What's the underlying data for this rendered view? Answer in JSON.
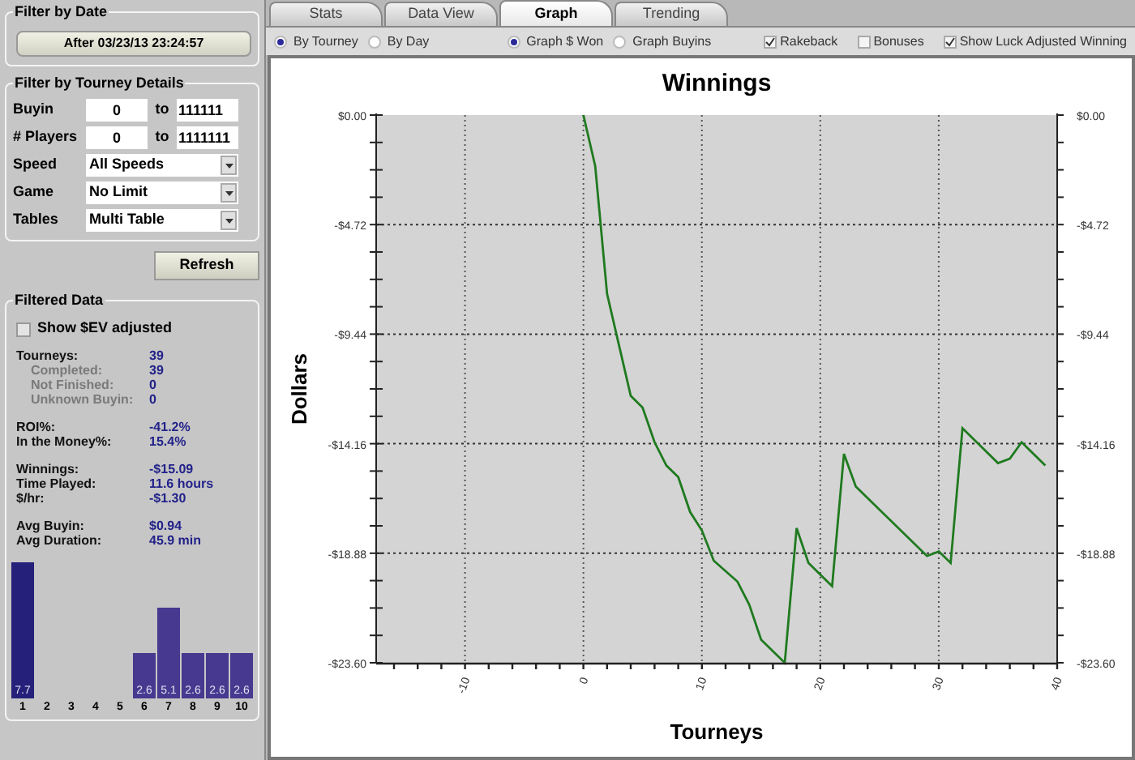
{
  "filter_by_date": {
    "title": "Filter by Date",
    "button": "After 03/23/13 23:24:57"
  },
  "filter_by_tourney": {
    "title": "Filter by Tourney Details",
    "ranges": [
      {
        "label": "Buyin",
        "from": "0",
        "to_label": "to",
        "to": "111111"
      },
      {
        "label": "# Players",
        "from": "0",
        "to_label": "to",
        "to": "1111111"
      }
    ],
    "dropdowns": [
      {
        "label": "Speed",
        "value": "All Speeds"
      },
      {
        "label": "Game",
        "value": "No Limit"
      },
      {
        "label": "Tables",
        "value": "Multi Table"
      }
    ]
  },
  "refresh_button": "Refresh",
  "filtered_data": {
    "title": "Filtered Data",
    "show_ev": {
      "label": "Show $EV adjusted",
      "checked": false
    },
    "stat_groups": [
      [
        {
          "label": "Tourneys:",
          "value": "39",
          "kind": "main"
        },
        {
          "label": "Completed:",
          "value": "39",
          "kind": "sub"
        },
        {
          "label": "Not Finished:",
          "value": "0",
          "kind": "sub"
        },
        {
          "label": "Unknown Buyin:",
          "value": "0",
          "kind": "sub"
        }
      ],
      [
        {
          "label": "ROI%:",
          "value": "-41.2%",
          "kind": "main"
        },
        {
          "label": "In the Money%:",
          "value": "15.4%",
          "kind": "main"
        }
      ],
      [
        {
          "label": "Winnings:",
          "value": "-$15.09",
          "kind": "main"
        },
        {
          "label": "Time Played:",
          "value": "11.6 hours",
          "kind": "main"
        },
        {
          "label": "$/hr:",
          "value": "-$1.30",
          "kind": "main"
        }
      ],
      [
        {
          "label": "Avg Buyin:",
          "value": "$0.94",
          "kind": "main"
        },
        {
          "label": "Avg Duration:",
          "value": "45.9 min",
          "kind": "main"
        }
      ]
    ],
    "chart_data": {
      "type": "bar",
      "categories": [
        "1",
        "2",
        "3",
        "4",
        "5",
        "6",
        "7",
        "8",
        "9",
        "10"
      ],
      "values": [
        7.7,
        null,
        null,
        null,
        null,
        2.6,
        5.1,
        2.6,
        2.6,
        2.6
      ],
      "data_labels": true
    }
  },
  "tabs": [
    {
      "label": "Stats",
      "selected": false
    },
    {
      "label": "Data View",
      "selected": false
    },
    {
      "label": "Graph",
      "selected": true
    },
    {
      "label": "Trending",
      "selected": false
    }
  ],
  "radio_groups": [
    [
      {
        "label": "By Tourney",
        "selected": true
      },
      {
        "label": "By Day",
        "selected": false
      }
    ],
    [
      {
        "label": "Graph $ Won",
        "selected": true
      },
      {
        "label": "Graph Buyins",
        "selected": false
      }
    ]
  ],
  "checkboxes": [
    {
      "label": "Rakeback",
      "checked": true
    },
    {
      "label": "Bonuses",
      "checked": false
    },
    {
      "label": "Show Luck Adjusted Winning",
      "checked": true
    }
  ],
  "graph": {
    "chart_data": {
      "type": "line",
      "title": "Winnings",
      "xlabel": "Tourneys",
      "ylabel": "Dollars",
      "x": [
        0,
        1,
        2,
        4,
        5,
        6,
        7,
        8,
        9,
        10,
        11,
        13,
        14,
        15,
        17,
        18,
        19,
        21,
        22,
        23,
        29,
        30,
        31,
        32,
        35,
        36,
        37,
        39
      ],
      "grid": true,
      "series": [
        {
          "color": "#1f7a1f",
          "values": [
            0,
            -2.2,
            -7.7,
            -12.1,
            -12.6,
            -14.1,
            -15.1,
            -15.6,
            -17.1,
            -17.9,
            -19.2,
            -20.1,
            -21.1,
            -22.6,
            -23.6,
            -17.8,
            -19.3,
            -20.3,
            -14.6,
            -16.0,
            -19.0,
            -18.8,
            -19.3,
            -13.5,
            -15.0,
            -14.8,
            -14.1,
            -15.1
          ]
        }
      ],
      "xlim": [
        -17.5,
        40
      ],
      "ylim": [
        -23.6,
        0
      ],
      "xticks": [
        -10,
        0,
        10,
        20,
        30,
        40
      ],
      "yticks": [
        {
          "value": 0,
          "label": "$0.00"
        },
        {
          "value": -4.72,
          "label": "-$4.72"
        },
        {
          "value": -9.44,
          "label": "-$9.44"
        },
        {
          "value": -14.16,
          "label": "-$14.16"
        },
        {
          "value": -18.88,
          "label": "-$18.88"
        },
        {
          "value": -23.6,
          "label": "-$23.60"
        }
      ]
    },
    "right_axis_labels": [
      "$0.00",
      "-$4.72",
      "-$9.44",
      "-$14.16",
      "-$18.88",
      "-$23.60"
    ]
  }
}
